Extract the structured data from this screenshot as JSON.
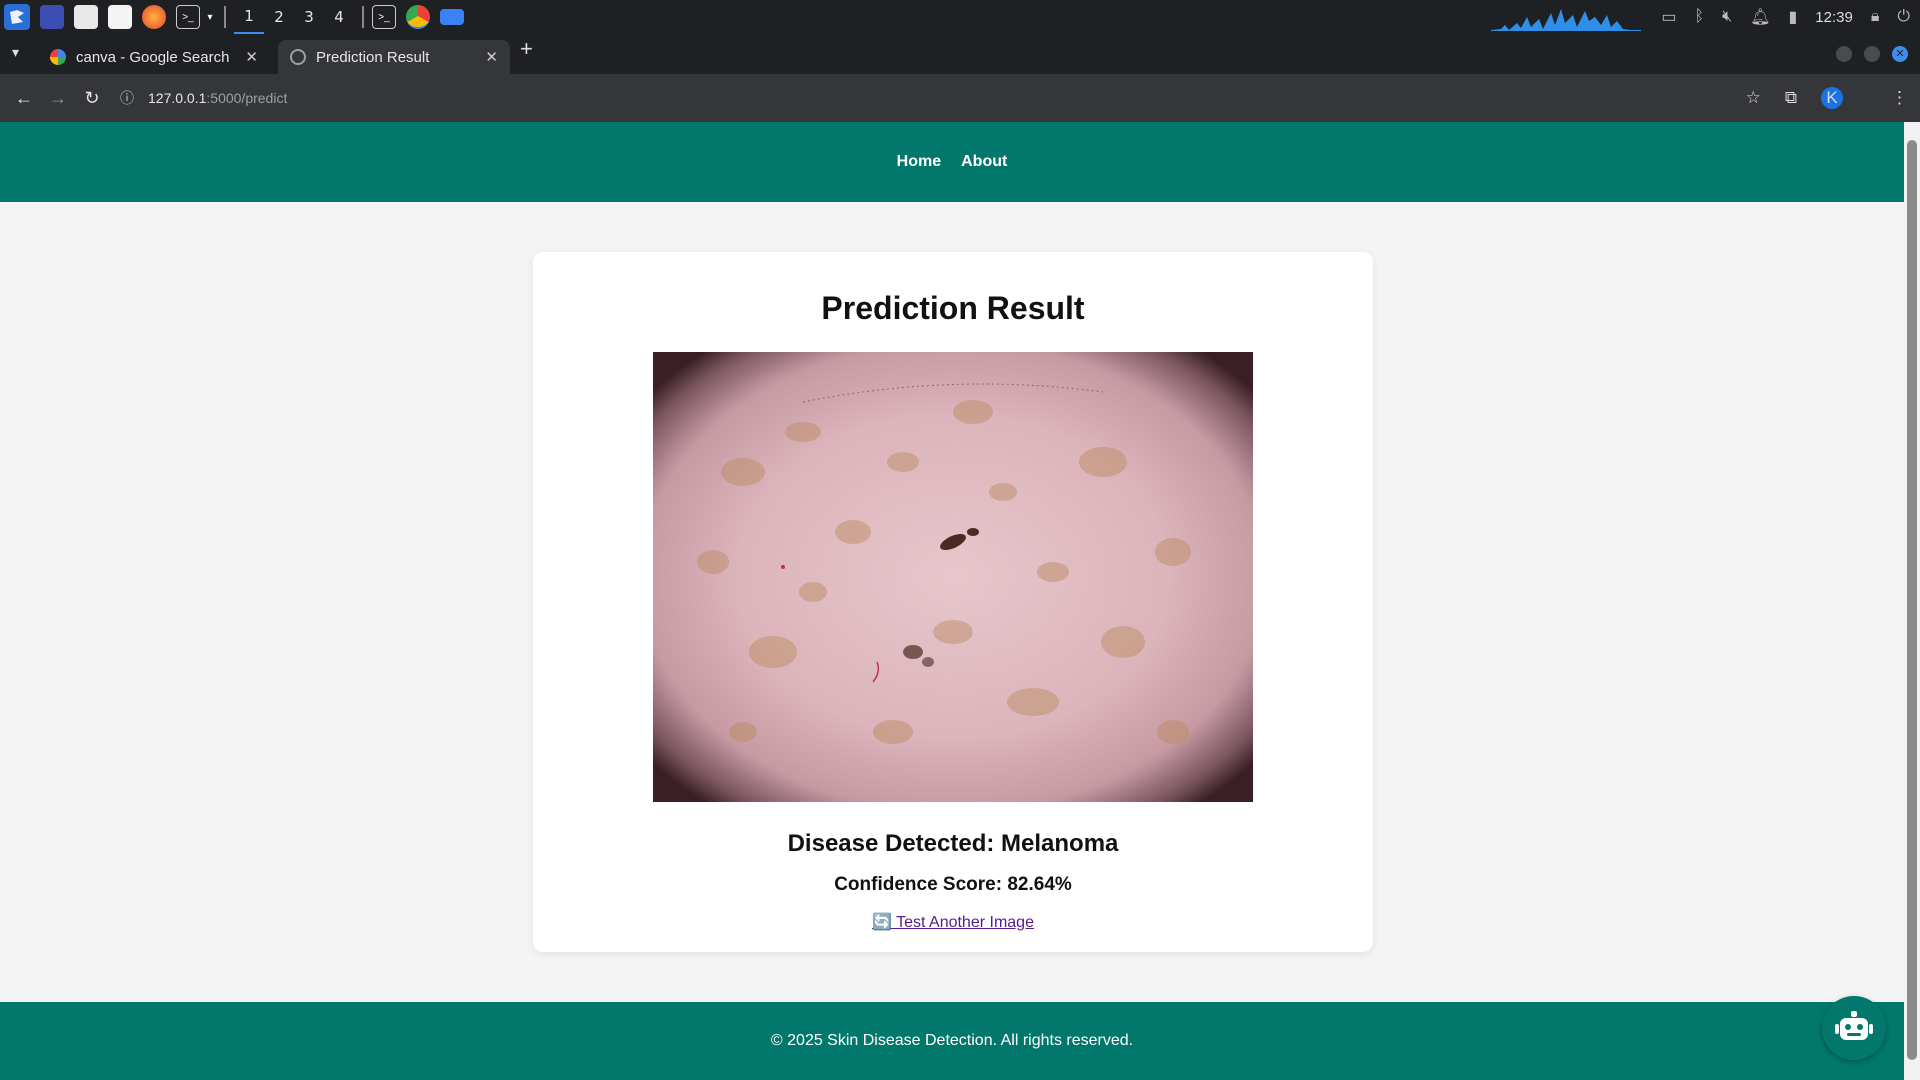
{
  "taskbar": {
    "workspaces": [
      "1",
      "2",
      "3",
      "4"
    ],
    "active_workspace": "1",
    "clock": "12:39"
  },
  "browser": {
    "tabs": [
      {
        "title": "canva - Google Search",
        "active": false
      },
      {
        "title": "Prediction Result",
        "active": true
      }
    ],
    "url_host": "127.0.0.1",
    "url_path": ":5000/predict",
    "profile_initial": "K"
  },
  "site": {
    "nav": {
      "home": "Home",
      "about": "About"
    },
    "title": "Prediction Result",
    "disease_label": "Disease Detected: Melanoma",
    "confidence_label": "Confidence Score: 82.64%",
    "retry_icon": "🔄",
    "retry_link": " Test Another Image",
    "footer": "© 2025 Skin Disease Detection. All rights reserved.",
    "colors": {
      "brand": "#02786d",
      "link": "#551a8b"
    }
  },
  "icons": {
    "chatbot": "robot-icon"
  }
}
